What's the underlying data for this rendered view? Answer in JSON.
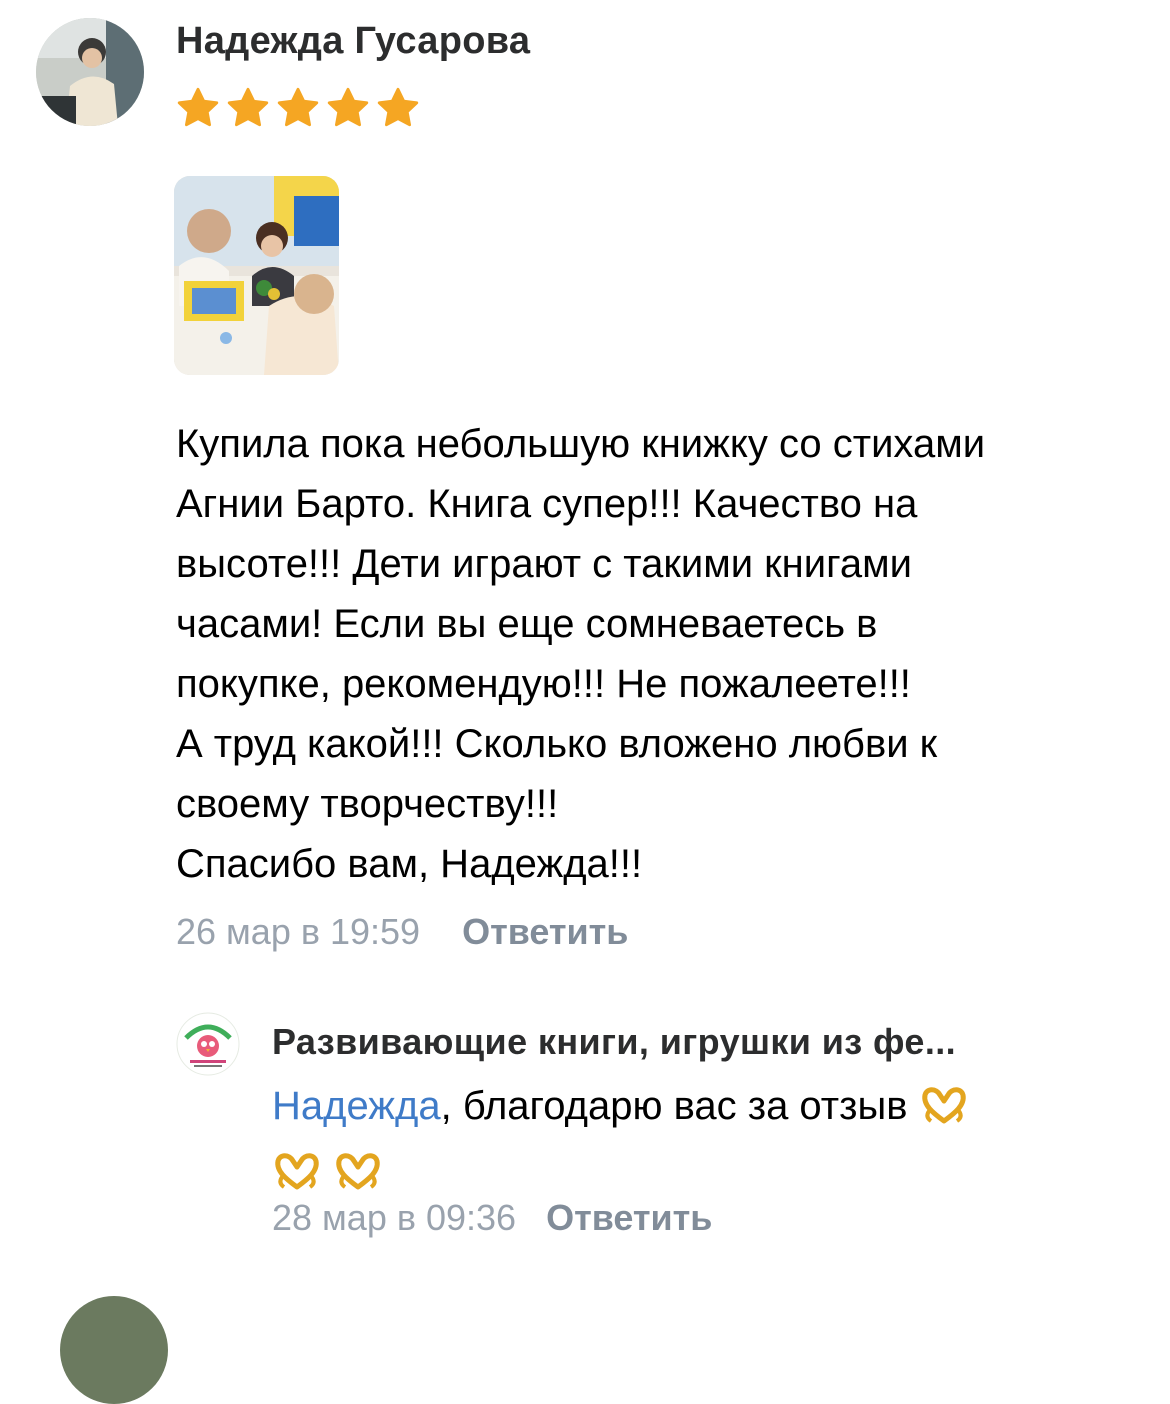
{
  "review": {
    "author": "Надежда Гусарова",
    "rating": 5,
    "rating_max": 5,
    "photo_icon": "photo-thumbnail",
    "text_lines": [
      "Купила пока небольшую книжку со стихами",
      "Агнии Барто. Книга супер!!! Качество на",
      "высоте!!! Дети играют с такими книгами",
      "часами! Если вы еще сомневаетесь в",
      "покупке, рекомендую!!! Не пожалеете!!!",
      "А труд какой!!! Сколько вложено любви к",
      "своему творчеству!!!",
      "Спасибо вам, Надежда!!!"
    ],
    "date": "26 мар в 19:59",
    "reply_label": "Ответить"
  },
  "reply": {
    "author": "Развивающие книги, игрушки из фе...",
    "mention": "Надежда",
    "text": ", благодарю вас за отзыв",
    "emoji_icon": "heart-hands-emoji",
    "date": "28 мар в 09:36",
    "reply_label": "Ответить"
  },
  "colors": {
    "name": "#2c2d2e",
    "star": "#f5a623",
    "link": "#3f7bc8",
    "meta": "#99a2ad",
    "action": "#818c99"
  }
}
